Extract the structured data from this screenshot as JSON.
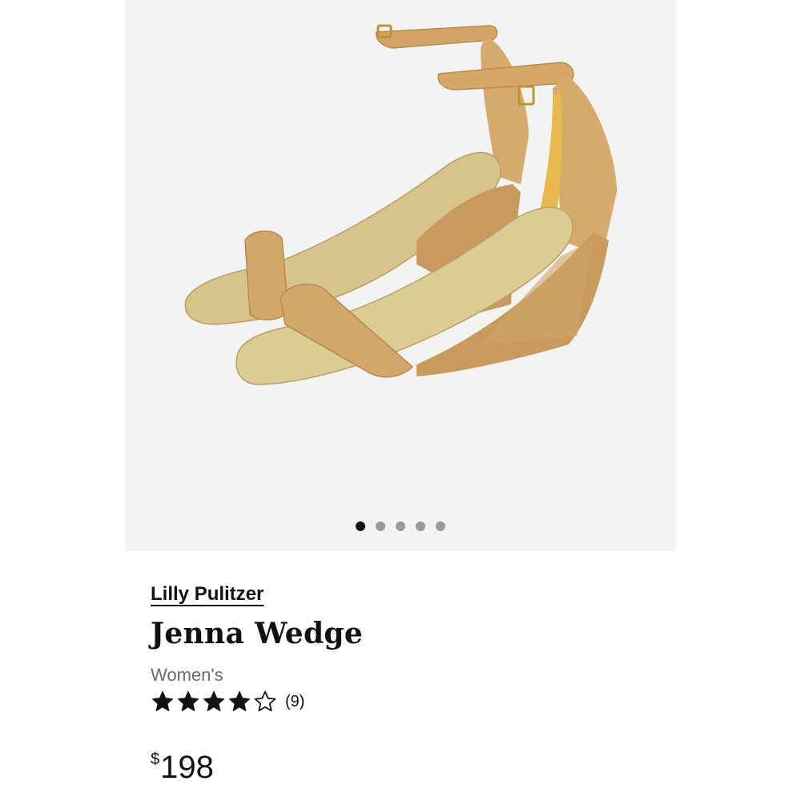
{
  "product": {
    "brand": "Lilly Pulitzer",
    "name": "Jenna Wedge",
    "gender": "Women's",
    "rating": {
      "stars_filled": 4,
      "stars_total": 5,
      "review_count": "(9)"
    },
    "price": {
      "currency_symbol": "$",
      "amount": "198"
    }
  },
  "gallery": {
    "image_count": 5,
    "active_index": 0
  },
  "colors": {
    "gallery_bg": "#f3f3f3",
    "text_primary": "#111111",
    "text_secondary": "#6b6b6b",
    "dot_inactive": "#9a9a9a"
  }
}
